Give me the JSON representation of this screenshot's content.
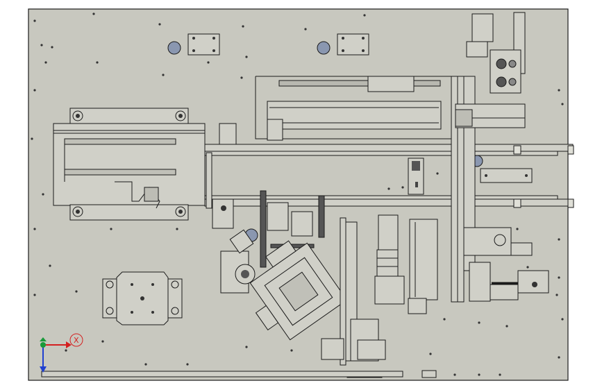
{
  "viewport": {
    "background": "#ffffff"
  },
  "drawing": {
    "plate_fill": "#c8c8bf",
    "line_color": "#1a1a1a",
    "part_fill": "#d0d0c8",
    "dark_fill": "#555555",
    "hole_fill": "#8a97b0"
  },
  "axis_triad": {
    "x_label": "X",
    "x_color": "#d42020",
    "y_color": "#2040d0",
    "origin_color": "#1a9a3a"
  }
}
